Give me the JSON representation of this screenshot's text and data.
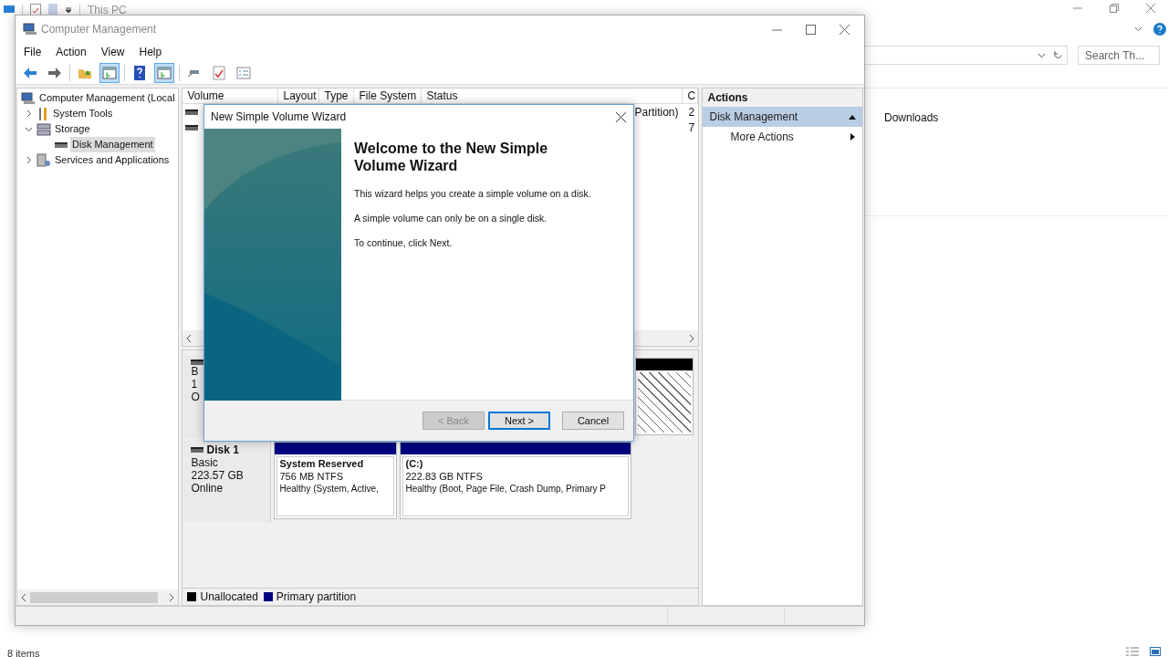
{
  "explorer": {
    "location": "This PC",
    "search": {
      "placeholder": "Search Th..."
    },
    "items": [
      {
        "label": "Downloads"
      }
    ],
    "status": "8 items"
  },
  "window": {
    "title": "Computer Management",
    "menu": [
      "File",
      "Action",
      "View",
      "Help"
    ],
    "toolbar": [
      {
        "buttons": [
          {
            "kind": "back",
            "pressed": false
          },
          {
            "kind": "forward",
            "pressed": false
          }
        ]
      },
      {
        "buttons": [
          {
            "kind": "folder",
            "pressed": false
          },
          {
            "kind": "pane",
            "pressed": true
          }
        ]
      },
      {
        "buttons": [
          {
            "kind": "help",
            "pressed": false
          },
          {
            "kind": "pane",
            "pressed": true
          }
        ]
      },
      {
        "buttons": [
          {
            "kind": "connect",
            "pressed": false
          },
          {
            "kind": "check",
            "pressed": false
          },
          {
            "kind": "list",
            "pressed": false
          }
        ]
      }
    ],
    "tree": [
      {
        "label": "Computer Management (Local",
        "kind": "computer",
        "selected": false,
        "children": [
          {
            "label": "System Tools",
            "kind": "tools",
            "expanded": false,
            "selected": false
          },
          {
            "label": "Storage",
            "kind": "storage",
            "expanded": true,
            "selected": false,
            "children": [
              {
                "label": "Disk Management",
                "kind": "disk",
                "selected": true
              }
            ]
          },
          {
            "label": "Services and Applications",
            "kind": "services",
            "expanded": false,
            "selected": false
          }
        ]
      }
    ],
    "volume_table": {
      "columns": [
        "Volume",
        "Layout",
        "Type",
        "File System",
        "Status",
        "C"
      ],
      "rows": [
        {
          "column_5": "Partition)",
          "column_6": "2"
        },
        {
          "column_6": "7"
        }
      ]
    },
    "disks": [
      {
        "lines": [
          "B",
          "1",
          "O"
        ],
        "partitions": [
          {
            "kind": "unallocated"
          }
        ]
      },
      {
        "name": "Disk 1",
        "lines": [
          "Basic",
          "223.57 GB",
          "Online"
        ],
        "partitions": [
          {
            "kind": "primary",
            "name": "System Reserved",
            "size": "756 MB NTFS",
            "status": "Healthy (System, Active,"
          },
          {
            "kind": "primary",
            "name": "(C:)",
            "size": "222.83 GB NTFS",
            "status": "Healthy (Boot, Page File, Crash Dump, Primary P"
          }
        ]
      }
    ],
    "legend": [
      {
        "label": "Unallocated",
        "color": "#000000"
      },
      {
        "label": "Primary partition",
        "color": "#000080"
      }
    ],
    "actions": {
      "title": "Actions",
      "sections": [
        {
          "label": "Disk Management",
          "expanded": true,
          "items": [
            {
              "label": "More Actions"
            }
          ]
        }
      ]
    }
  },
  "wizard": {
    "title": "New Simple Volume Wizard",
    "heading": "Welcome to the New Simple Volume Wizard",
    "paragraphs": [
      "This wizard helps you create a simple volume on a disk.",
      "A simple volume can only be on a single disk.",
      "To continue, click Next."
    ],
    "buttons": [
      {
        "label": "< Back",
        "disabled": true,
        "focused": false
      },
      {
        "label": "Next >",
        "disabled": false,
        "focused": true
      },
      {
        "label": "Cancel",
        "disabled": false,
        "focused": false
      }
    ]
  }
}
